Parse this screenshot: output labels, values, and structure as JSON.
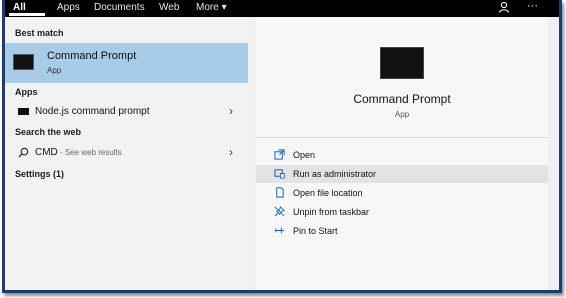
{
  "topbar": {
    "tabs": [
      {
        "label": "All"
      },
      {
        "label": "Apps"
      },
      {
        "label": "Documents"
      },
      {
        "label": "Web"
      },
      {
        "label": "More"
      }
    ],
    "more_caret": "▾",
    "ellipsis": "···"
  },
  "left": {
    "best_match_title": "Best match",
    "best_match": {
      "name": "Command Prompt",
      "sub": "App"
    },
    "apps_title": "Apps",
    "apps": [
      {
        "label": "Node.js command prompt"
      }
    ],
    "web_title": "Search the web",
    "web": {
      "query": "CMD",
      "suffix": " - See web results"
    },
    "settings_title": "Settings (1)",
    "chevron": "›"
  },
  "right": {
    "title": "Command Prompt",
    "sub": "App",
    "actions": [
      {
        "label": "Open",
        "icon": "open-icon"
      },
      {
        "label": "Run as administrator",
        "icon": "run-as-admin-icon"
      },
      {
        "label": "Open file location",
        "icon": "file-location-icon"
      },
      {
        "label": "Unpin from taskbar",
        "icon": "unpin-icon"
      },
      {
        "label": "Pin to Start",
        "icon": "pin-icon"
      }
    ]
  },
  "colors": {
    "selected": "#a8cbe8",
    "accent_icon": "#1565c0",
    "topbar": "#000000"
  }
}
